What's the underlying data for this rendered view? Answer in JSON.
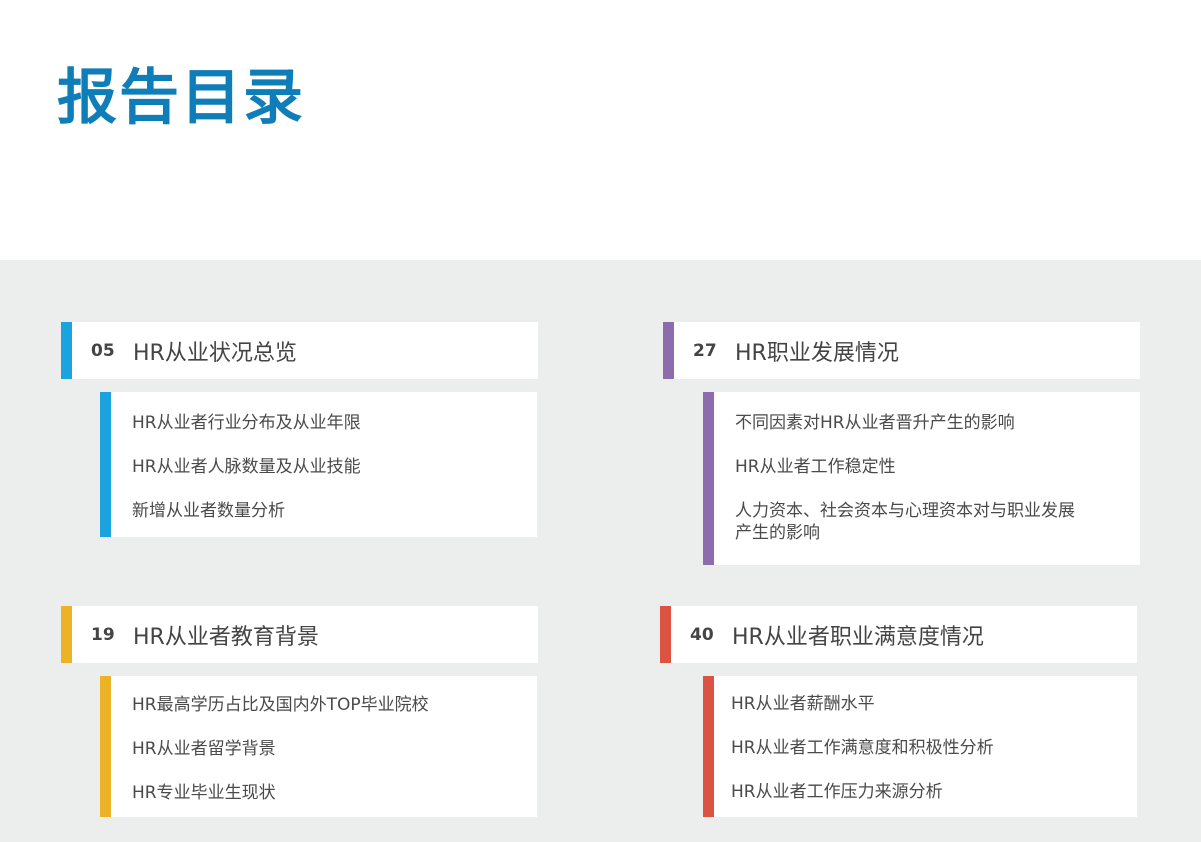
{
  "page_title": "报告目录",
  "colors": {
    "title": "#0e7db8",
    "blue": "#1aa3dc",
    "purple": "#8d6cae",
    "yellow": "#ecb326",
    "red": "#dc5344",
    "background_lower": "#eceeed"
  },
  "sections": [
    {
      "number": "05",
      "title": "HR从业状况总览",
      "items": [
        "HR从业者行业分布及从业年限",
        "HR从业者人脉数量及从业技能",
        "新增从业者数量分析"
      ]
    },
    {
      "number": "27",
      "title": "HR职业发展情况",
      "items": [
        "不同因素对HR从业者晋升产生的影响",
        "HR从业者工作稳定性",
        "人力资本、社会资本与心理资本对与职业发展",
        "产生的影响"
      ]
    },
    {
      "number": "19",
      "title": "HR从业者教育背景",
      "items": [
        "HR最高学历占比及国内外TOP毕业院校",
        "HR从业者留学背景",
        "HR专业毕业生现状"
      ]
    },
    {
      "number": "40",
      "title": "HR从业者职业满意度情况",
      "items": [
        "HR从业者薪酬水平",
        "HR从业者工作满意度和积极性分析",
        "HR从业者工作压力来源分析"
      ]
    }
  ]
}
